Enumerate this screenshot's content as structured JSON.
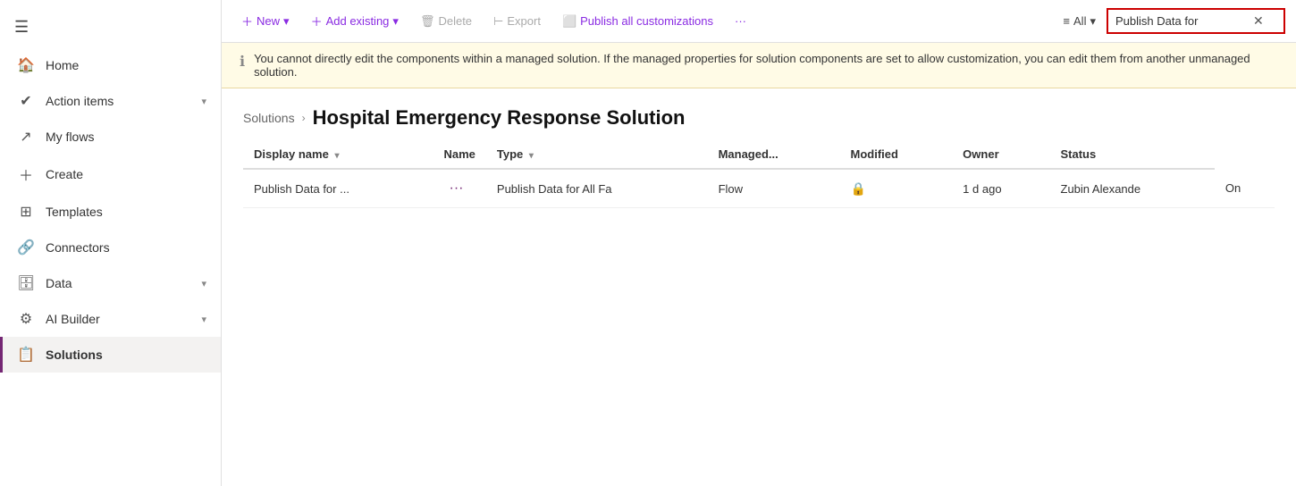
{
  "sidebar": {
    "hamburger": "☰",
    "items": [
      {
        "id": "home",
        "label": "Home",
        "icon": "🏠",
        "hasChevron": false,
        "active": false
      },
      {
        "id": "action-items",
        "label": "Action items",
        "icon": "✓",
        "hasChevron": true,
        "active": false
      },
      {
        "id": "my-flows",
        "label": "My flows",
        "icon": "↗",
        "hasChevron": false,
        "active": false
      },
      {
        "id": "create",
        "label": "Create",
        "icon": "+",
        "hasChevron": false,
        "active": false
      },
      {
        "id": "templates",
        "label": "Templates",
        "icon": "⊞",
        "hasChevron": false,
        "active": false
      },
      {
        "id": "connectors",
        "label": "Connectors",
        "icon": "🔗",
        "hasChevron": false,
        "active": false
      },
      {
        "id": "data",
        "label": "Data",
        "icon": "🗄",
        "hasChevron": true,
        "active": false
      },
      {
        "id": "ai-builder",
        "label": "AI Builder",
        "icon": "⚙",
        "hasChevron": true,
        "active": false
      },
      {
        "id": "solutions",
        "label": "Solutions",
        "icon": "📋",
        "hasChevron": false,
        "active": true
      }
    ]
  },
  "toolbar": {
    "new_label": "New",
    "add_existing_label": "Add existing",
    "delete_label": "Delete",
    "export_label": "Export",
    "publish_all_label": "Publish all customizations",
    "more_label": "···",
    "filter_label": "All",
    "search_value": "Publish Data for"
  },
  "warning": {
    "text": "You cannot directly edit the components within a managed solution. If the managed properties for solution components are set to allow customization, you can edit them from another unmanaged solution."
  },
  "breadcrumb": {
    "parent_label": "Solutions",
    "current_label": "Hospital Emergency Response Solution"
  },
  "table": {
    "columns": [
      {
        "id": "display-name",
        "label": "Display name",
        "sortable": true
      },
      {
        "id": "name",
        "label": "Name",
        "sortable": false
      },
      {
        "id": "type",
        "label": "Type",
        "sortable": true
      },
      {
        "id": "managed",
        "label": "Managed...",
        "sortable": false
      },
      {
        "id": "modified",
        "label": "Modified",
        "sortable": false
      },
      {
        "id": "owner",
        "label": "Owner",
        "sortable": false
      },
      {
        "id": "status",
        "label": "Status",
        "sortable": false
      }
    ],
    "rows": [
      {
        "display_name": "Publish Data for ...",
        "name": "Publish Data for All Fa",
        "type": "Flow",
        "managed_icon": "🔒",
        "modified": "1 d ago",
        "owner": "Zubin Alexande",
        "status": "On"
      }
    ]
  }
}
